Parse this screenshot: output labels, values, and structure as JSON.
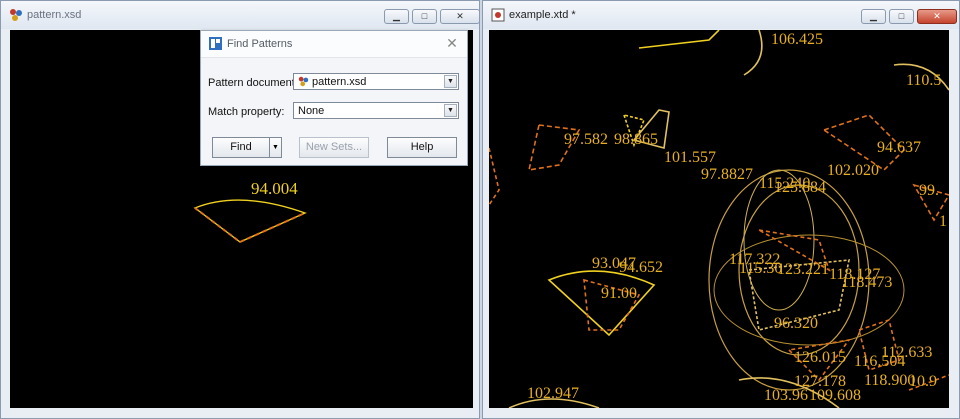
{
  "left_window": {
    "title": "pattern.xsd",
    "app_icon": "pattern-doc-icon",
    "controls": {
      "minimize": "▁",
      "maximize": "□",
      "close": "✕"
    },
    "shape_label": "94.004"
  },
  "right_window": {
    "title": "example.xtd *",
    "app_icon": "example-doc-icon",
    "controls": {
      "minimize": "▁",
      "maximize": "□",
      "close": "✕"
    },
    "labels": [
      "106.425",
      "110.5",
      "97.582",
      "98.865",
      "101.557",
      "94.637",
      "102.020",
      "97.8827",
      "115.240",
      "125.684",
      "99.",
      "1",
      "93.047",
      "94.652",
      "117.322",
      "115.30",
      "123.221",
      "118.127",
      "118.473",
      "91.00",
      "96.320",
      "112.633",
      "126.015",
      "116.504",
      "118.900",
      "127.178",
      "103.96",
      "109.608",
      "10.9",
      "102.947"
    ]
  },
  "find_dialog": {
    "title": "Find Patterns",
    "pattern_document_label": "Pattern document:",
    "pattern_document_value": "pattern.xsd",
    "match_property_label": "Match property:",
    "match_property_value": "None",
    "find_button": "Find",
    "new_sets_button": "New Sets...",
    "help_button": "Help",
    "close_glyph": "✕"
  },
  "colors": {
    "canvas_bg": "#000000",
    "shape_yellow": "#f0d020",
    "shape_orange": "#e0701a",
    "label_orange": "#e8b020"
  }
}
